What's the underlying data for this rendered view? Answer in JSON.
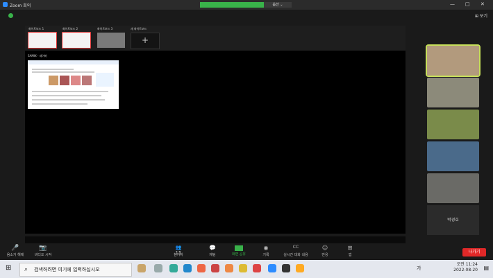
{
  "window": {
    "title": "Zoom 회의",
    "share_control_label": "옵션 ⌄",
    "minimize": "—",
    "maximize": "□",
    "close": "✕"
  },
  "header": {
    "view_button": "⊞ 보기"
  },
  "thumbnails": [
    {
      "label": "화이트보드 1"
    },
    {
      "label": "화이트보드 2"
    },
    {
      "label": "화이트보드 3"
    },
    {
      "label": "새 화이트보드",
      "add": "+"
    }
  ],
  "shared_window": {
    "label": "SAMIK - 네이버"
  },
  "controls": [
    {
      "label": "음소거 해제"
    },
    {
      "label": "비디오 시작"
    },
    {
      "label": "참가자",
      "count": "15"
    },
    {
      "label": "채팅"
    },
    {
      "label": "화면 공유"
    },
    {
      "label": "기록"
    },
    {
      "label": "실시간 대화 내용"
    },
    {
      "label": "반응"
    },
    {
      "label": "앱"
    }
  ],
  "leave_button": "나가기",
  "gallery": {
    "name_tile": "박경호"
  },
  "taskbar": {
    "search_placeholder": "검색하려면 여기에 입력하십시오",
    "time": "오전 11:24",
    "date": "2022-08-20",
    "lang": "가"
  },
  "colors": {
    "share_green": "#39b24a",
    "leave_red": "#e02828",
    "active_speaker": "#c7e05a",
    "accent_blue": "#2d8cff"
  }
}
